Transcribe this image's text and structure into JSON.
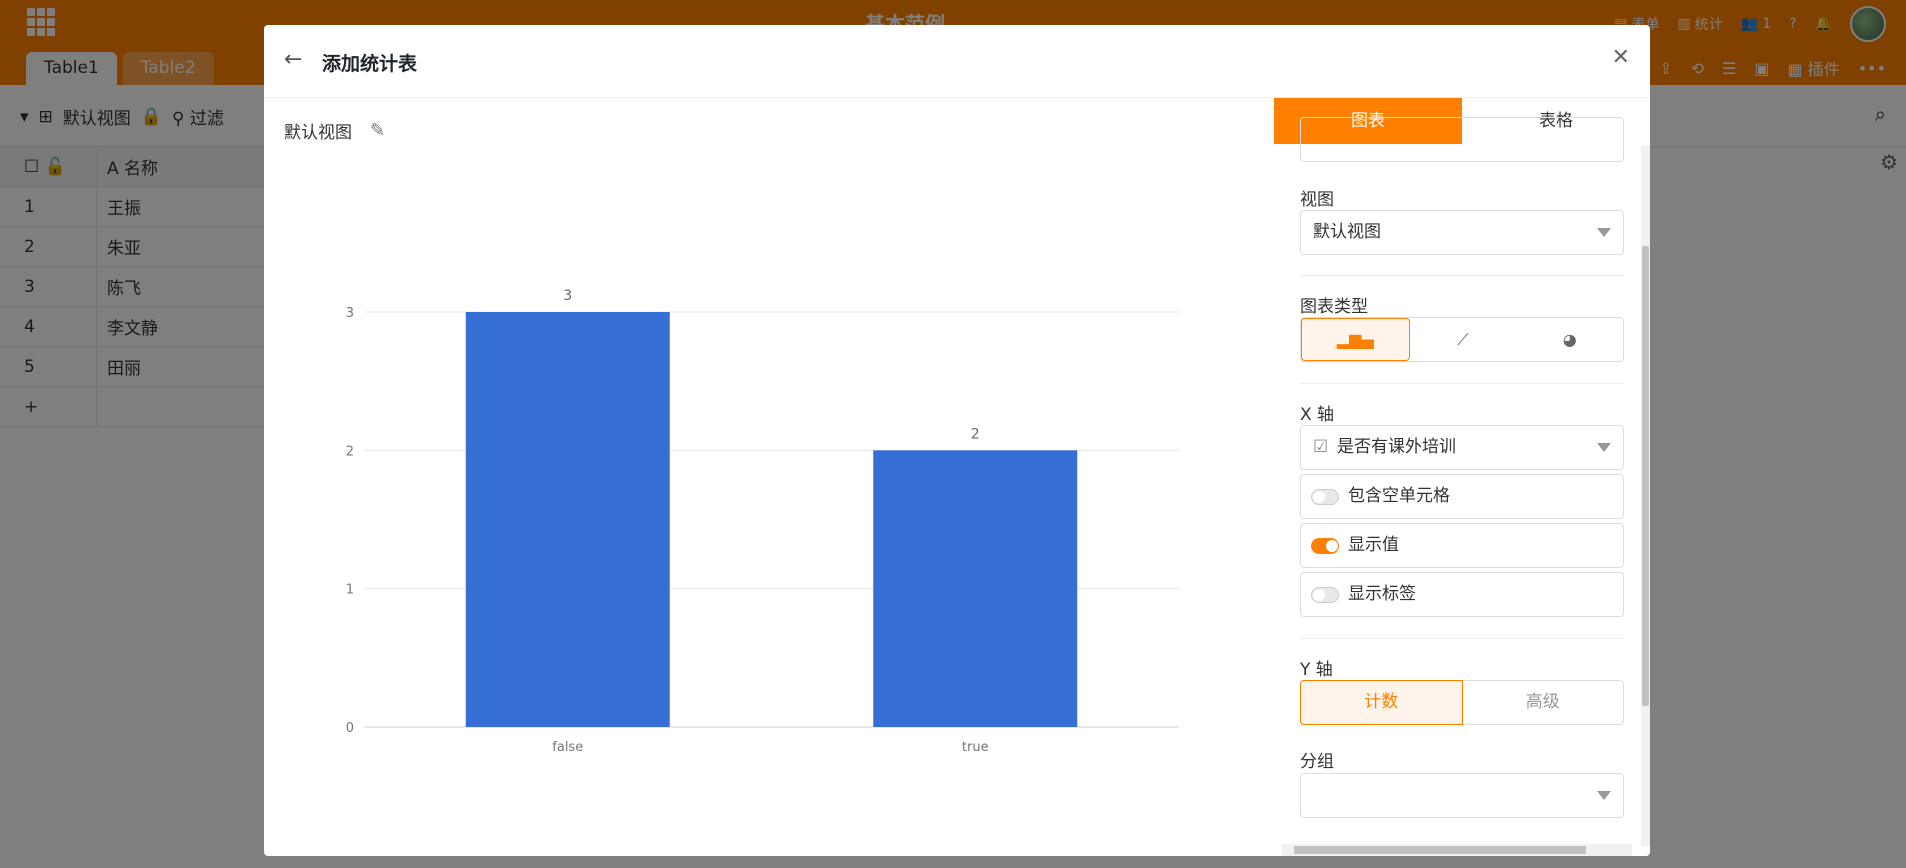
{
  "app": {
    "title": "基本范例",
    "tables": [
      "Table1",
      "Table2"
    ],
    "form_label": "表单",
    "stats_label": "统计",
    "member_count": "1",
    "plugins_label": "插件",
    "view_name": "默认视图",
    "filter_label": "过滤",
    "name_column": "名称",
    "rows": [
      {
        "num": "1",
        "name": "王振"
      },
      {
        "num": "2",
        "name": "朱亚"
      },
      {
        "num": "3",
        "name": "陈飞"
      },
      {
        "num": "4",
        "name": "李文静"
      },
      {
        "num": "5",
        "name": "田丽"
      }
    ]
  },
  "modal": {
    "title": "添加统计表",
    "view_label": "默认视图",
    "tabs": {
      "chart": "图表",
      "table": "表格"
    },
    "settings": {
      "view_section": "视图",
      "view_value": "默认视图",
      "chart_type_section": "图表类型",
      "x_axis_section": "X 轴",
      "x_axis_field": "是否有课外培训",
      "include_empty": "包含空单元格",
      "show_values": "显示值",
      "show_labels": "显示标签",
      "y_axis_section": "Y 轴",
      "y_count": "计数",
      "y_advanced": "高级",
      "group_section": "分组"
    }
  },
  "chart_data": {
    "type": "bar",
    "categories": [
      "false",
      "true"
    ],
    "values": [
      3,
      2
    ],
    "y_ticks": [
      "0",
      "1",
      "2",
      "3"
    ],
    "ylim": [
      0,
      3
    ],
    "bar_color": "#356fd5",
    "show_values": true
  }
}
